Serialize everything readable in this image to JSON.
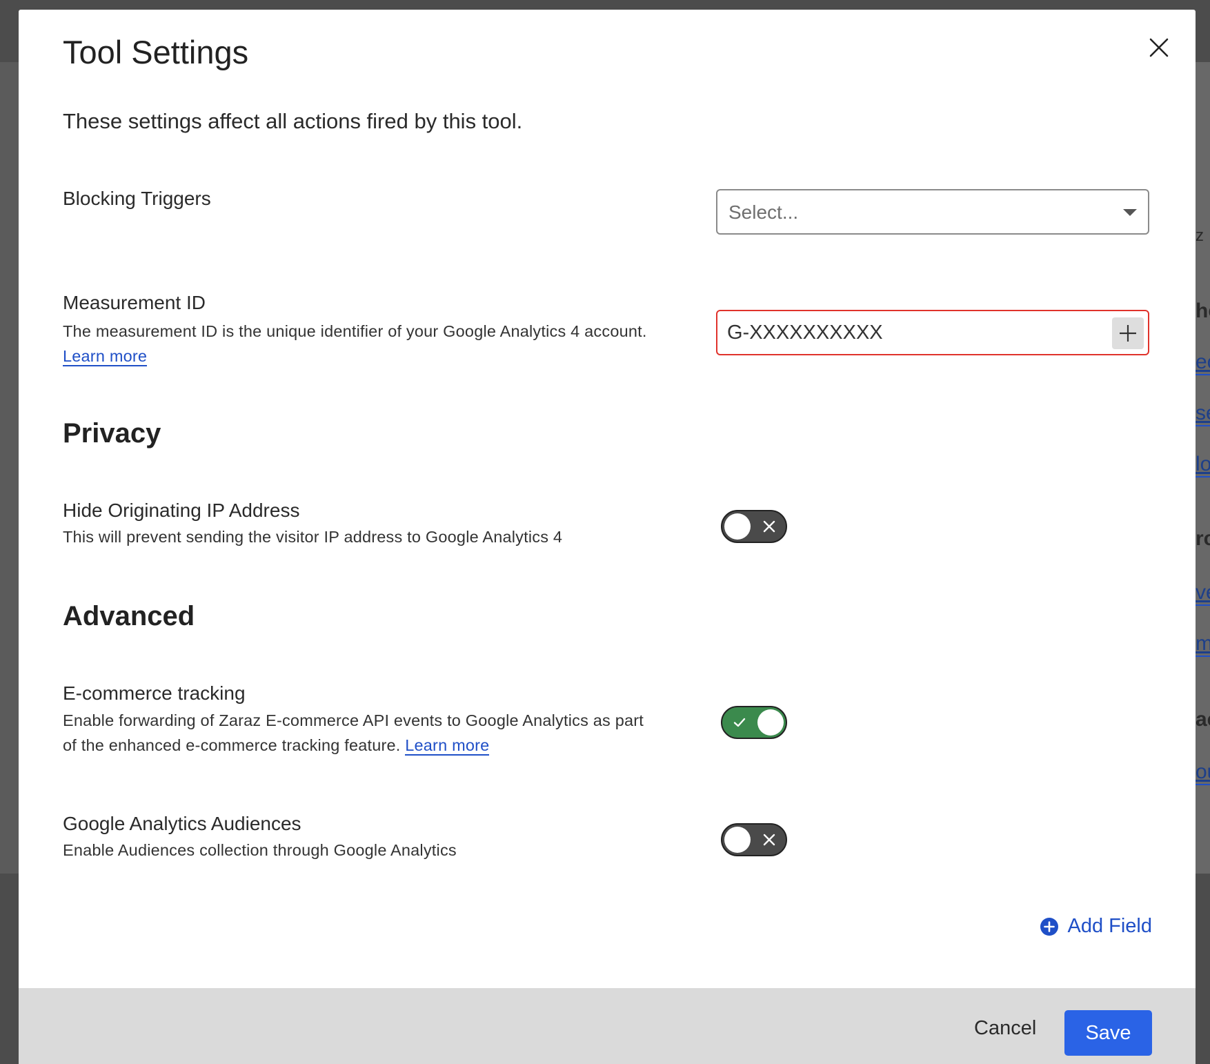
{
  "background": {
    "fragments": [
      {
        "text": "z",
        "style": "plain"
      },
      {
        "text": "he",
        "style": "bold"
      },
      {
        "text": "ec",
        "style": "link"
      },
      {
        "text": "se",
        "style": "link"
      },
      {
        "text": "lo",
        "style": "link"
      },
      {
        "text": "rc",
        "style": "bold"
      },
      {
        "text": "ve",
        "style": "link"
      },
      {
        "text": "m",
        "style": "link"
      },
      {
        "text": "ac",
        "style": "bold"
      },
      {
        "text": "ou",
        "style": "link"
      }
    ]
  },
  "modal": {
    "title": "Tool Settings",
    "close_icon": "close-icon",
    "intro": "These settings affect all actions fired by this tool.",
    "blocking_triggers": {
      "label": "Blocking Triggers",
      "placeholder": "Select...",
      "caret_icon": "caret-down-icon"
    },
    "measurement_id": {
      "label": "Measurement ID",
      "description": "The measurement ID is the unique identifier of your Google Analytics 4 account.",
      "link": "Learn more",
      "value": "G-XXXXXXXXXX",
      "add_icon": "plus-icon",
      "state": "error",
      "border_color": "#e0322b"
    },
    "privacy": {
      "heading": "Privacy",
      "hide_ip": {
        "label": "Hide Originating IP Address",
        "description": "This will prevent sending the visitor IP address to Google Analytics 4",
        "enabled": false
      }
    },
    "advanced": {
      "heading": "Advanced",
      "ecommerce": {
        "label": "E-commerce tracking",
        "description_line1": "Enable forwarding of Zaraz E-commerce API events to Google Analytics as part",
        "description_line2": "of the enhanced e-commerce tracking feature.",
        "link": "Learn more",
        "enabled": true
      },
      "audiences": {
        "label": "Google Analytics Audiences",
        "description": "Enable Audiences collection through Google Analytics",
        "enabled": false
      }
    },
    "add_field": {
      "label": "Add Field",
      "icon": "plus-circle-icon"
    },
    "footer": {
      "cancel_label": "Cancel",
      "save_label": "Save"
    }
  },
  "colors": {
    "primary": "#2a63e6",
    "link": "#1f4fc7",
    "error": "#e0322b",
    "toggle_on": "#3b8a4d",
    "toggle_off": "#4a4a4a",
    "footer_bg": "#dadada"
  }
}
